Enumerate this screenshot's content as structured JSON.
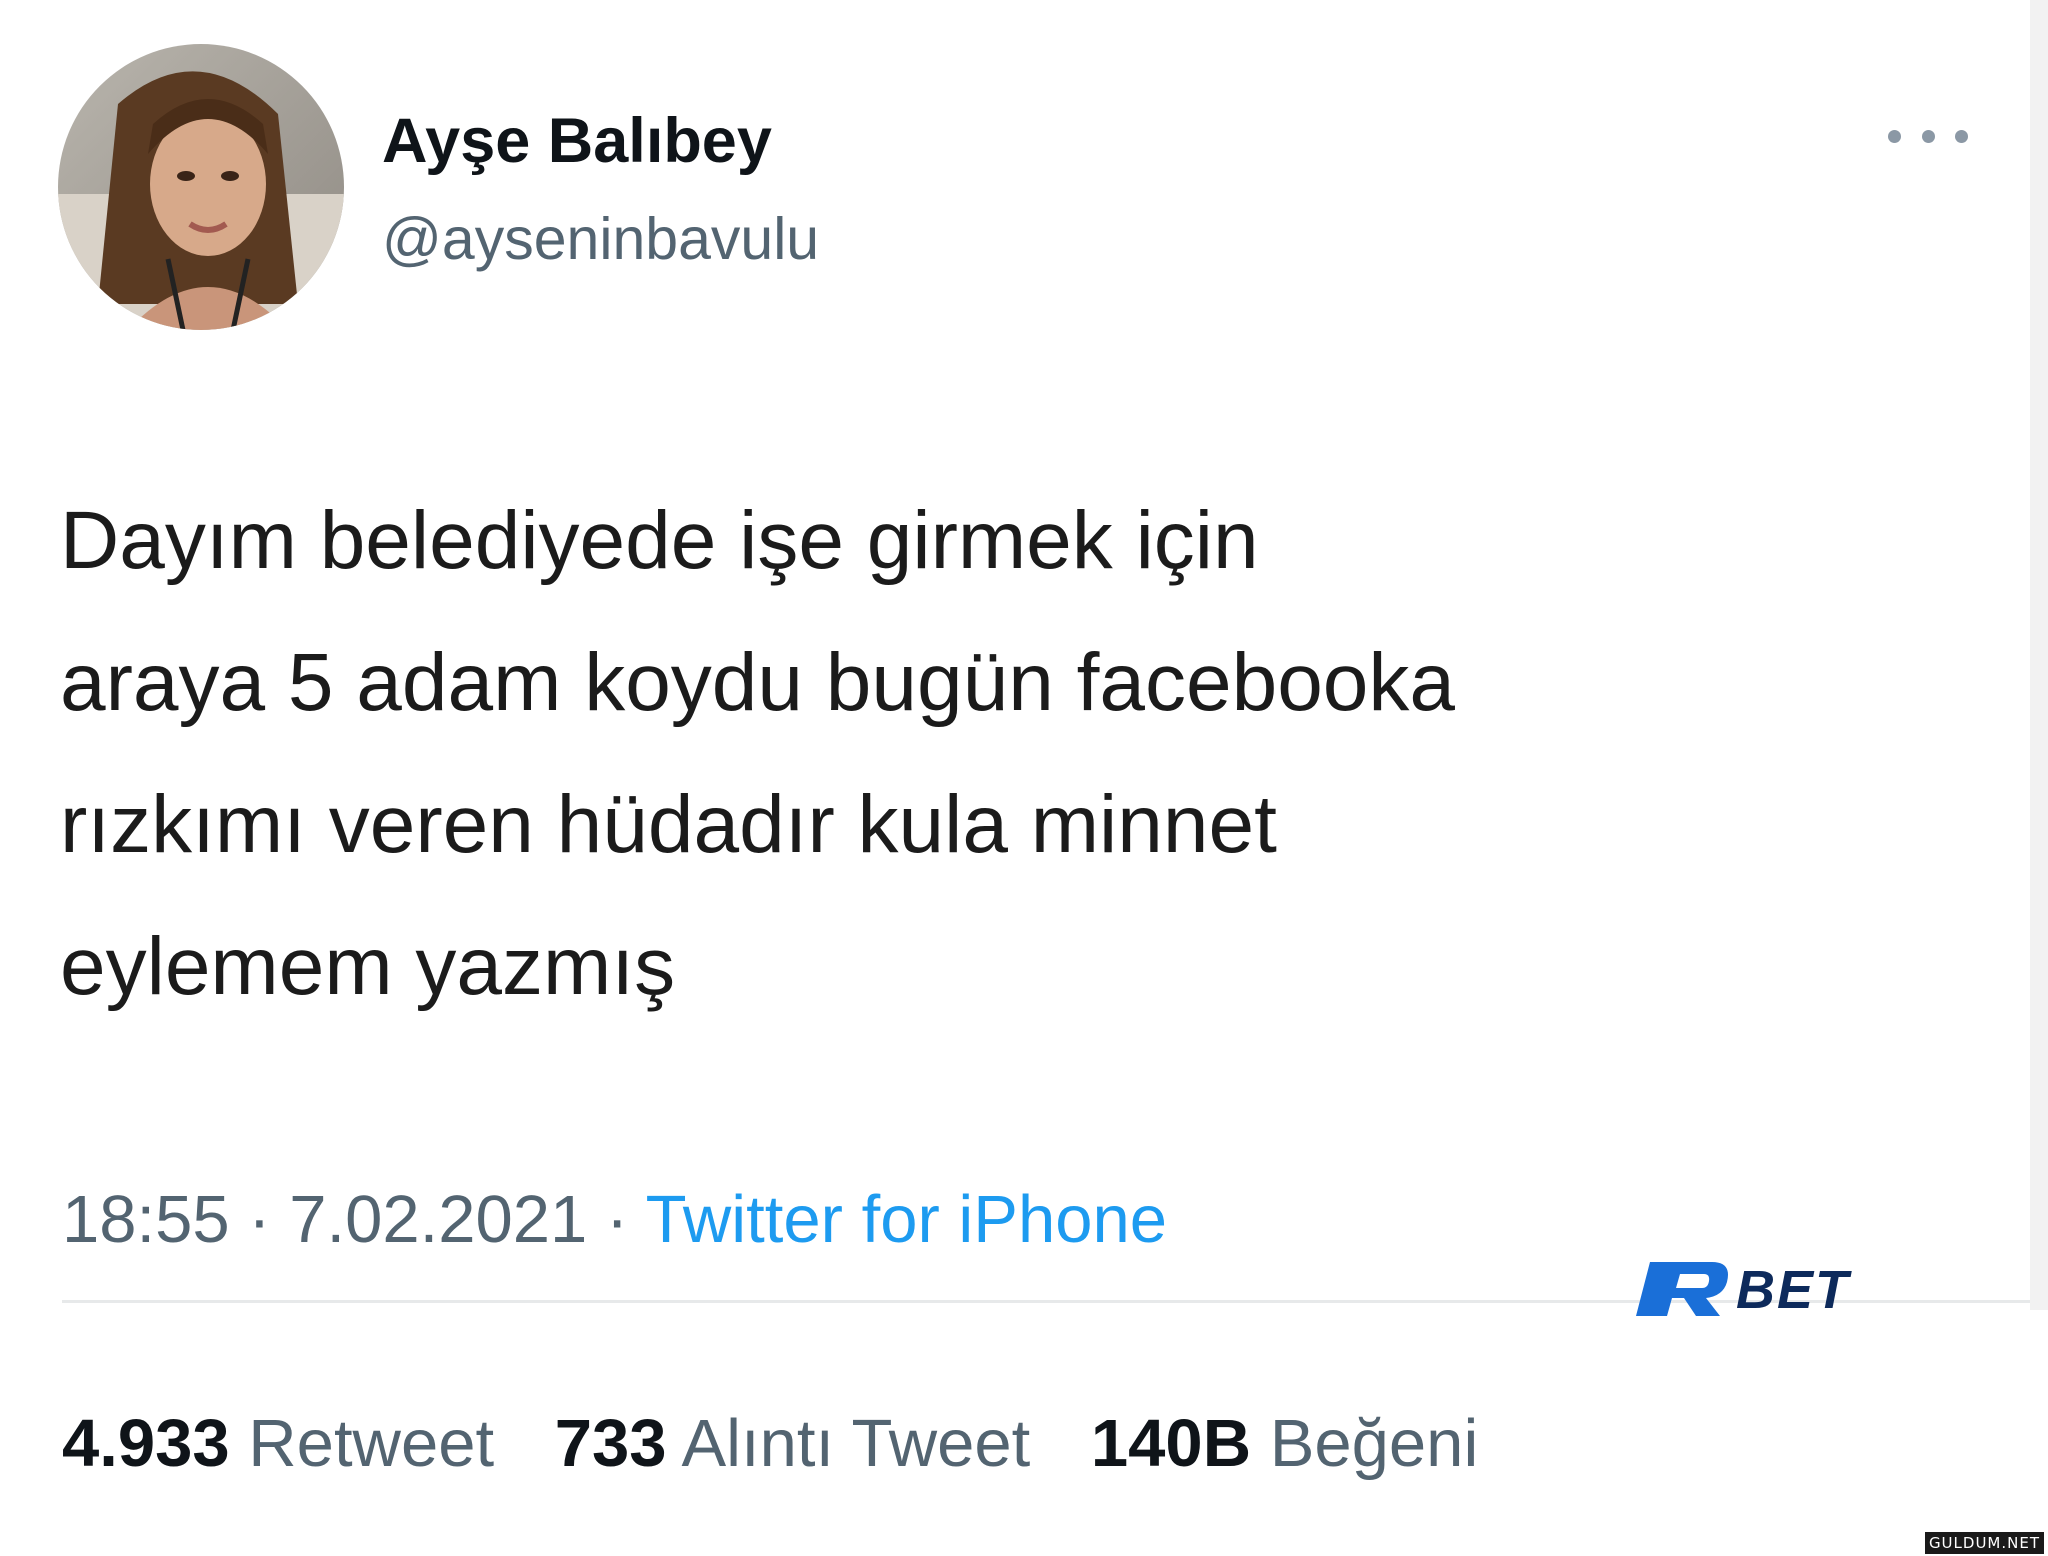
{
  "tweet": {
    "author": {
      "display_name": "Ayşe Balıbey",
      "handle": "@ayseninbavulu"
    },
    "text_lines": [
      "Dayım belediyede işe girmek için",
      "araya 5 adam koydu bugün facebooka",
      "rızkımı veren hüdadır kula minnet",
      "eylemem yazmış"
    ],
    "time": "18:55",
    "date": "7.02.2021",
    "separator": "·",
    "source": "Twitter for iPhone",
    "stats": {
      "retweet_count": "4.933",
      "retweet_label": "Retweet",
      "quote_count": "733",
      "quote_label": "Alıntı Tweet",
      "like_count": "140B",
      "like_label": "Beğeni"
    }
  },
  "watermark": {
    "logo_letter": "R",
    "logo_text": "BET",
    "site_badge": "GULDUM.NET"
  },
  "colors": {
    "text_primary": "#0f1419",
    "text_secondary": "#536471",
    "link": "#1d9bf0",
    "watermark_blue": "#1a6fd8",
    "watermark_navy": "#0d2a5b"
  },
  "icons": {
    "more": "more-dots-icon"
  }
}
